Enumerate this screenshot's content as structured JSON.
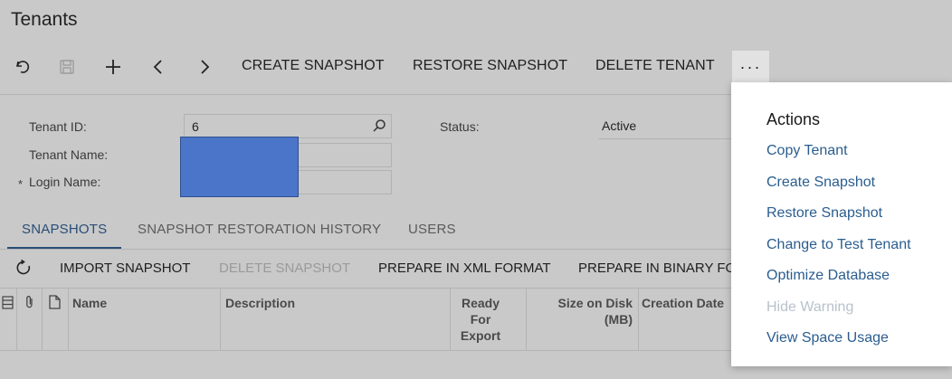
{
  "page": {
    "title": "Tenants"
  },
  "toolbar": {
    "create_snapshot": "CREATE SNAPSHOT",
    "restore_snapshot": "RESTORE SNAPSHOT",
    "delete_tenant": "DELETE TENANT",
    "more": "···"
  },
  "form": {
    "tenant_id_label": "Tenant ID:",
    "tenant_id_value": "6",
    "tenant_name_label": "Tenant Name:",
    "login_name_label": "Login Name:",
    "required_mark": "*",
    "status_label": "Status:",
    "status_value": "Active"
  },
  "tabs": [
    {
      "label": "SNAPSHOTS",
      "active": true
    },
    {
      "label": "SNAPSHOT RESTORATION HISTORY",
      "active": false
    },
    {
      "label": "USERS",
      "active": false
    }
  ],
  "grid_toolbar": {
    "import_snapshot": "IMPORT SNAPSHOT",
    "delete_snapshot": "DELETE SNAPSHOT",
    "prepare_xml": "PREPARE IN XML FORMAT",
    "prepare_binary": "PREPARE IN BINARY FO"
  },
  "grid": {
    "columns": {
      "name": "Name",
      "description": "Description",
      "ready_for_export": [
        "Ready",
        "For",
        "Export"
      ],
      "size_on_disk": [
        "Size on Disk",
        "(MB)"
      ],
      "creation_date": "Creation Date"
    }
  },
  "actions_menu": {
    "heading": "Actions",
    "items": [
      {
        "label": "Copy Tenant",
        "enabled": true
      },
      {
        "label": "Create Snapshot",
        "enabled": true
      },
      {
        "label": "Restore Snapshot",
        "enabled": true
      },
      {
        "label": "Change to Test Tenant",
        "enabled": true
      },
      {
        "label": "Optimize Database",
        "enabled": true
      },
      {
        "label": "Hide Warning",
        "enabled": false
      },
      {
        "label": "View Space Usage",
        "enabled": true
      }
    ]
  },
  "colors": {
    "accent": "#284e78",
    "link": "#2a5d8f",
    "overlay_bg": "#c9c9c9",
    "redaction": "#4a75c9"
  }
}
